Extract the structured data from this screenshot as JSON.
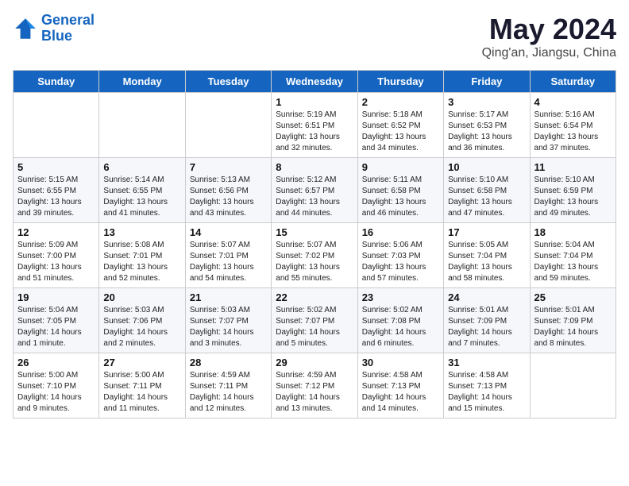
{
  "header": {
    "logo_line1": "General",
    "logo_line2": "Blue",
    "title": "May 2024",
    "subtitle": "Qing'an, Jiangsu, China"
  },
  "calendar": {
    "days_of_week": [
      "Sunday",
      "Monday",
      "Tuesday",
      "Wednesday",
      "Thursday",
      "Friday",
      "Saturday"
    ],
    "weeks": [
      [
        {
          "day": "",
          "info": ""
        },
        {
          "day": "",
          "info": ""
        },
        {
          "day": "",
          "info": ""
        },
        {
          "day": "1",
          "info": "Sunrise: 5:19 AM\nSunset: 6:51 PM\nDaylight: 13 hours\nand 32 minutes."
        },
        {
          "day": "2",
          "info": "Sunrise: 5:18 AM\nSunset: 6:52 PM\nDaylight: 13 hours\nand 34 minutes."
        },
        {
          "day": "3",
          "info": "Sunrise: 5:17 AM\nSunset: 6:53 PM\nDaylight: 13 hours\nand 36 minutes."
        },
        {
          "day": "4",
          "info": "Sunrise: 5:16 AM\nSunset: 6:54 PM\nDaylight: 13 hours\nand 37 minutes."
        }
      ],
      [
        {
          "day": "5",
          "info": "Sunrise: 5:15 AM\nSunset: 6:55 PM\nDaylight: 13 hours\nand 39 minutes."
        },
        {
          "day": "6",
          "info": "Sunrise: 5:14 AM\nSunset: 6:55 PM\nDaylight: 13 hours\nand 41 minutes."
        },
        {
          "day": "7",
          "info": "Sunrise: 5:13 AM\nSunset: 6:56 PM\nDaylight: 13 hours\nand 43 minutes."
        },
        {
          "day": "8",
          "info": "Sunrise: 5:12 AM\nSunset: 6:57 PM\nDaylight: 13 hours\nand 44 minutes."
        },
        {
          "day": "9",
          "info": "Sunrise: 5:11 AM\nSunset: 6:58 PM\nDaylight: 13 hours\nand 46 minutes."
        },
        {
          "day": "10",
          "info": "Sunrise: 5:10 AM\nSunset: 6:58 PM\nDaylight: 13 hours\nand 47 minutes."
        },
        {
          "day": "11",
          "info": "Sunrise: 5:10 AM\nSunset: 6:59 PM\nDaylight: 13 hours\nand 49 minutes."
        }
      ],
      [
        {
          "day": "12",
          "info": "Sunrise: 5:09 AM\nSunset: 7:00 PM\nDaylight: 13 hours\nand 51 minutes."
        },
        {
          "day": "13",
          "info": "Sunrise: 5:08 AM\nSunset: 7:01 PM\nDaylight: 13 hours\nand 52 minutes."
        },
        {
          "day": "14",
          "info": "Sunrise: 5:07 AM\nSunset: 7:01 PM\nDaylight: 13 hours\nand 54 minutes."
        },
        {
          "day": "15",
          "info": "Sunrise: 5:07 AM\nSunset: 7:02 PM\nDaylight: 13 hours\nand 55 minutes."
        },
        {
          "day": "16",
          "info": "Sunrise: 5:06 AM\nSunset: 7:03 PM\nDaylight: 13 hours\nand 57 minutes."
        },
        {
          "day": "17",
          "info": "Sunrise: 5:05 AM\nSunset: 7:04 PM\nDaylight: 13 hours\nand 58 minutes."
        },
        {
          "day": "18",
          "info": "Sunrise: 5:04 AM\nSunset: 7:04 PM\nDaylight: 13 hours\nand 59 minutes."
        }
      ],
      [
        {
          "day": "19",
          "info": "Sunrise: 5:04 AM\nSunset: 7:05 PM\nDaylight: 14 hours\nand 1 minute."
        },
        {
          "day": "20",
          "info": "Sunrise: 5:03 AM\nSunset: 7:06 PM\nDaylight: 14 hours\nand 2 minutes."
        },
        {
          "day": "21",
          "info": "Sunrise: 5:03 AM\nSunset: 7:07 PM\nDaylight: 14 hours\nand 3 minutes."
        },
        {
          "day": "22",
          "info": "Sunrise: 5:02 AM\nSunset: 7:07 PM\nDaylight: 14 hours\nand 5 minutes."
        },
        {
          "day": "23",
          "info": "Sunrise: 5:02 AM\nSunset: 7:08 PM\nDaylight: 14 hours\nand 6 minutes."
        },
        {
          "day": "24",
          "info": "Sunrise: 5:01 AM\nSunset: 7:09 PM\nDaylight: 14 hours\nand 7 minutes."
        },
        {
          "day": "25",
          "info": "Sunrise: 5:01 AM\nSunset: 7:09 PM\nDaylight: 14 hours\nand 8 minutes."
        }
      ],
      [
        {
          "day": "26",
          "info": "Sunrise: 5:00 AM\nSunset: 7:10 PM\nDaylight: 14 hours\nand 9 minutes."
        },
        {
          "day": "27",
          "info": "Sunrise: 5:00 AM\nSunset: 7:11 PM\nDaylight: 14 hours\nand 11 minutes."
        },
        {
          "day": "28",
          "info": "Sunrise: 4:59 AM\nSunset: 7:11 PM\nDaylight: 14 hours\nand 12 minutes."
        },
        {
          "day": "29",
          "info": "Sunrise: 4:59 AM\nSunset: 7:12 PM\nDaylight: 14 hours\nand 13 minutes."
        },
        {
          "day": "30",
          "info": "Sunrise: 4:58 AM\nSunset: 7:13 PM\nDaylight: 14 hours\nand 14 minutes."
        },
        {
          "day": "31",
          "info": "Sunrise: 4:58 AM\nSunset: 7:13 PM\nDaylight: 14 hours\nand 15 minutes."
        },
        {
          "day": "",
          "info": ""
        }
      ]
    ]
  }
}
